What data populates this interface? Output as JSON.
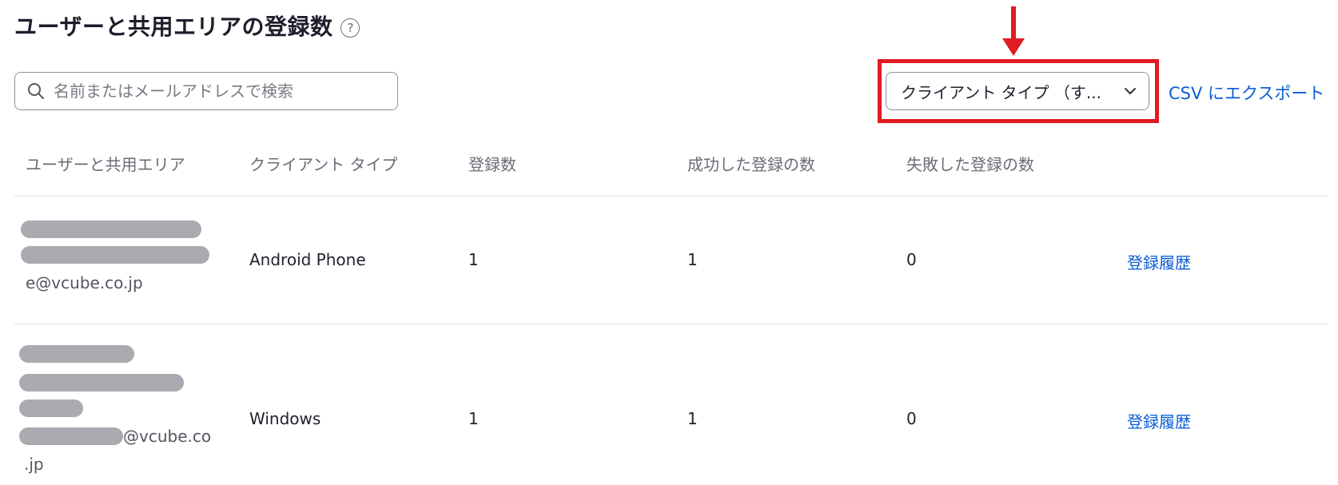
{
  "title": "ユーザーと共用エリアの登録数",
  "help_icon_glyph": "?",
  "search": {
    "placeholder": "名前またはメールアドレスで検索",
    "value": ""
  },
  "filter": {
    "label": "クライアント タイプ （す..."
  },
  "export_label": "CSV にエクスポート",
  "annotation_color": "#e01b22",
  "accent_color": "#0b5cd5",
  "table": {
    "columns": [
      "ユーザーと共用エリア",
      "クライアント タイプ",
      "登録数",
      "成功した登録の数",
      "失敗した登録の数"
    ],
    "rows": [
      {
        "user_email": "e@vcube.co.jp",
        "client_type": "Android Phone",
        "registrations": "1",
        "successful": "1",
        "failed": "0",
        "history_label": "登録履歴"
      },
      {
        "user_email_line1": "@vcube.co",
        "user_email_line2": ".jp",
        "client_type": "Windows",
        "registrations": "1",
        "successful": "1",
        "failed": "0",
        "history_label": "登録履歴"
      }
    ]
  }
}
